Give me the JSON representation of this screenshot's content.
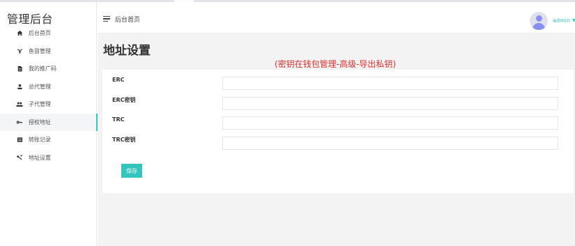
{
  "app": {
    "title": "管理后台"
  },
  "sidebar": {
    "items": [
      {
        "label": "后台首页",
        "icon": "home-icon"
      },
      {
        "label": "鱼苗管理",
        "icon": "fish-icon"
      },
      {
        "label": "我的推广码",
        "icon": "document-icon"
      },
      {
        "label": "总代管理",
        "icon": "user-icon"
      },
      {
        "label": "子代管理",
        "icon": "users-icon"
      },
      {
        "label": "授权地址",
        "icon": "key-icon",
        "active": true
      },
      {
        "label": "转账记录",
        "icon": "list-icon"
      },
      {
        "label": "地址设置",
        "icon": "settings-key-icon"
      }
    ]
  },
  "header": {
    "breadcrumb": "后台首页",
    "user": "admin"
  },
  "main": {
    "title": "地址设置",
    "note": "(密钥在钱包管理-高级-导出私钥)",
    "fields": [
      {
        "label": "ERC",
        "value": ""
      },
      {
        "label": "ERC密钥",
        "value": ""
      },
      {
        "label": "TRC",
        "value": ""
      },
      {
        "label": "TRC密钥",
        "value": ""
      }
    ],
    "save_label": "保存"
  },
  "colors": {
    "accent": "#32c5bd",
    "note": "#e0302b",
    "content_bg": "#f3f3f4"
  }
}
